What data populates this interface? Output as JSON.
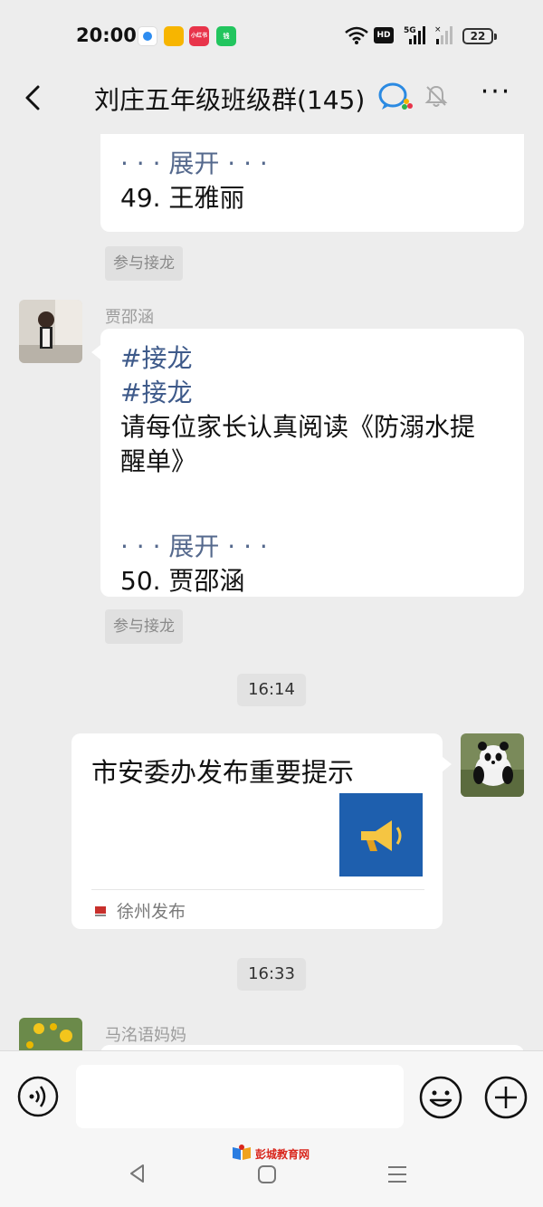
{
  "status_bar": {
    "time": "20:00",
    "apps": [
      "",
      "",
      "小红书",
      "钱"
    ],
    "hd_label": "HD",
    "network": "5G",
    "battery": "22"
  },
  "header": {
    "title": "刘庄五年级班级群(145)",
    "icons": [
      "back-icon",
      "wecom-icon",
      "mute-bell-icon",
      "more-icon"
    ],
    "more_label": "···"
  },
  "messages": [
    {
      "type": "jielong-partial",
      "expand_text": "· · · 展开 · · ·",
      "last_entry": "49. 王雅丽",
      "join_label": "参与接龙"
    },
    {
      "type": "jielong",
      "sender": "贾邵涵",
      "lines": [
        "#接龙",
        "#接龙",
        "请每位家长认真阅读《防溺水提",
        "醒单》"
      ],
      "expand_text": "· · · 展开 · · ·",
      "last_entry": "50. 贾邵涵",
      "join_label": "参与接龙"
    },
    {
      "type": "timestamp",
      "text": "16:14"
    },
    {
      "type": "link-card",
      "title": "市安委办发布重要提示",
      "source": "徐州发布",
      "thumb_icon": "megaphone-icon"
    },
    {
      "type": "timestamp",
      "text": "16:33"
    },
    {
      "type": "incoming-partial",
      "sender": "马洺语妈妈"
    }
  ],
  "input_bar": {
    "placeholder": "",
    "icons": [
      "voice-icon",
      "emoji-icon",
      "plus-icon"
    ]
  },
  "watermark": {
    "text": "彭城教育网"
  },
  "colors": {
    "background": "#ededed",
    "bubble": "#ffffff",
    "hashtag": "#3e5a8a",
    "card_thumb": "#1e5fae"
  }
}
